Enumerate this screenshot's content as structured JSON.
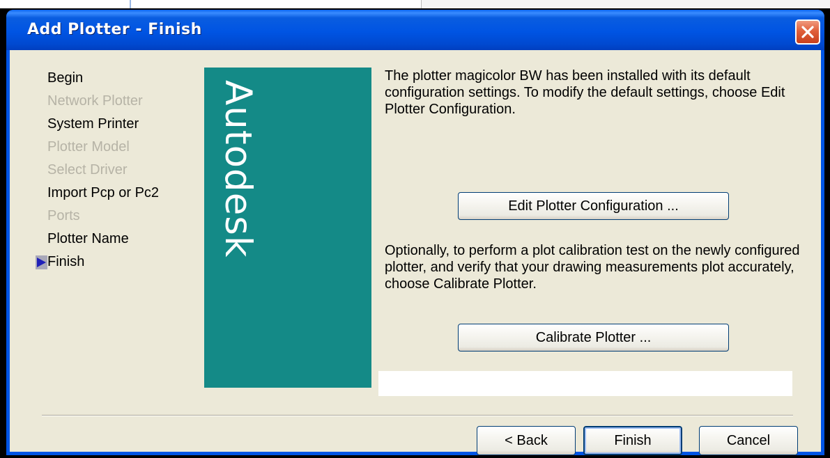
{
  "window": {
    "title": "Add Plotter - Finish"
  },
  "steps": [
    {
      "label": "Begin",
      "state": "enabled"
    },
    {
      "label": "Network Plotter",
      "state": "disabled"
    },
    {
      "label": "System Printer",
      "state": "enabled"
    },
    {
      "label": "Plotter Model",
      "state": "disabled"
    },
    {
      "label": "Select Driver",
      "state": "disabled"
    },
    {
      "label": "Import Pcp or Pc2",
      "state": "enabled"
    },
    {
      "label": "Ports",
      "state": "disabled"
    },
    {
      "label": "Plotter Name",
      "state": "enabled"
    },
    {
      "label": "Finish",
      "state": "current"
    }
  ],
  "banner": {
    "logo_text": "Autodesk"
  },
  "content": {
    "intro_text": "The plotter magicolor BW has been installed with its default configuration settings.  To modify the default settings, choose Edit Plotter Configuration.",
    "edit_button_label": "Edit Plotter Configuration ...",
    "calibrate_text": "Optionally, to perform a plot calibration test on the newly configured plotter, and verify that your drawing measurements plot accurately, choose Calibrate Plotter.",
    "calibrate_button_label": "Calibrate Plotter ..."
  },
  "footer": {
    "back_label": "< Back",
    "finish_label": "Finish",
    "cancel_label": "Cancel"
  },
  "colors": {
    "titlebar": "#0054e3",
    "client_bg": "#ece9d8",
    "banner_bg": "#148a87",
    "disabled_text": "#b6b3a6",
    "close_button": "#e0603b",
    "current_step_marker": "#1f1fb8"
  },
  "icons": {
    "close": "close-x-icon",
    "current_step": "arrow-right-icon"
  }
}
